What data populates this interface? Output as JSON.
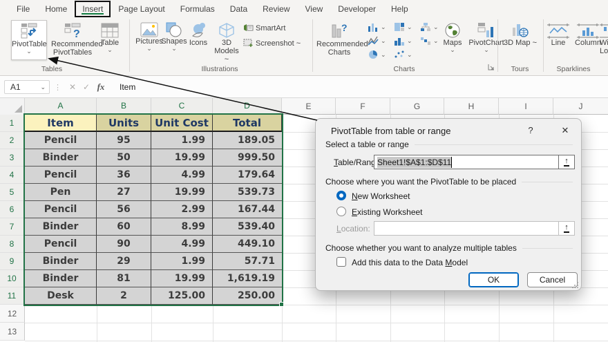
{
  "ribbon": {
    "tabs": [
      {
        "label": "File"
      },
      {
        "label": "Home"
      },
      {
        "label": "Insert",
        "active": true
      },
      {
        "label": "Page Layout"
      },
      {
        "label": "Formulas"
      },
      {
        "label": "Data"
      },
      {
        "label": "Review"
      },
      {
        "label": "View"
      },
      {
        "label": "Developer"
      },
      {
        "label": "Help"
      }
    ],
    "groups": {
      "tables": {
        "label": "Tables",
        "pivottable": "PivotTable",
        "recommended_pivottables": "Recommended PivotTables",
        "table": "Table"
      },
      "illustrations": {
        "label": "Illustrations",
        "pictures": "Pictures",
        "shapes": "Shapes",
        "icons": "Icons",
        "models3d": "3D Models ~",
        "smartart": "SmartArt",
        "screenshot": "Screenshot ~"
      },
      "charts": {
        "label": "Charts",
        "recommended_charts": "Recommended Charts",
        "maps": "Maps",
        "pivotchart": "PivotChart"
      },
      "tours": {
        "label": "Tours",
        "map3d": "3D Map ~"
      },
      "sparklines": {
        "label": "Sparklines",
        "line": "Line",
        "column": "Column",
        "winloss": "Win/ Loss"
      }
    }
  },
  "formula_bar": {
    "cell_ref": "A1",
    "formula": "Item"
  },
  "sheet": {
    "column_letters": [
      "A",
      "B",
      "C",
      "D",
      "E",
      "F",
      "G",
      "H",
      "I",
      "J"
    ],
    "selected_row_numbers": [
      "1",
      "2",
      "3",
      "4",
      "5",
      "6",
      "7",
      "8",
      "9",
      "10",
      "11"
    ],
    "other_row_numbers": [
      "12",
      "13"
    ],
    "table": {
      "headers": [
        "Item",
        "Units",
        "Unit Cost",
        "Total"
      ],
      "rows": [
        [
          "Pencil",
          "95",
          "1.99",
          "189.05"
        ],
        [
          "Binder",
          "50",
          "19.99",
          "999.50"
        ],
        [
          "Pencil",
          "36",
          "4.99",
          "179.64"
        ],
        [
          "Pen",
          "27",
          "19.99",
          "539.73"
        ],
        [
          "Pencil",
          "56",
          "2.99",
          "167.44"
        ],
        [
          "Binder",
          "60",
          "8.99",
          "539.40"
        ],
        [
          "Pencil",
          "90",
          "4.99",
          "449.10"
        ],
        [
          "Binder",
          "29",
          "1.99",
          "57.71"
        ],
        [
          "Binder",
          "81",
          "19.99",
          "1,619.19"
        ],
        [
          "Desk",
          "2",
          "125.00",
          "250.00"
        ]
      ]
    }
  },
  "dialog": {
    "title": "PivotTable from table or range",
    "section_table": "Select a table or range",
    "table_range_label": {
      "key": "T",
      "post": "able/Range:"
    },
    "table_range_value": "Sheet1!$A$1:$D$11",
    "section_placement": "Choose where you want the PivotTable to be placed",
    "radio_new": {
      "key": "N",
      "post": "ew Worksheet"
    },
    "radio_existing": {
      "key": "E",
      "post": "xisting Worksheet"
    },
    "location_label": {
      "key": "L",
      "post": "ocation:"
    },
    "location_value": "",
    "section_multiple": "Choose whether you want to analyze multiple tables",
    "checkbox_label": {
      "pre": "Add this data to the Data ",
      "key": "M",
      "post": "odel"
    },
    "ok": "OK",
    "cancel": "Cancel"
  },
  "icons": {
    "chevron": "⌄",
    "dots": "⋮",
    "cancel_x": "✕",
    "check": "✓",
    "fx": "fx",
    "help": "?",
    "close": "✕",
    "collapse_range": "↑"
  },
  "colors": {
    "excel_green": "#217346",
    "tab_underline": "#107c41",
    "table_header_fill": "#d9d3a0",
    "active_cell_fill": "#fbf2be",
    "table_header_text": "#1f3864",
    "selection_gray": "#d4d4d4",
    "radio_blue": "#0067c0",
    "ok_border": "#0067c0"
  }
}
